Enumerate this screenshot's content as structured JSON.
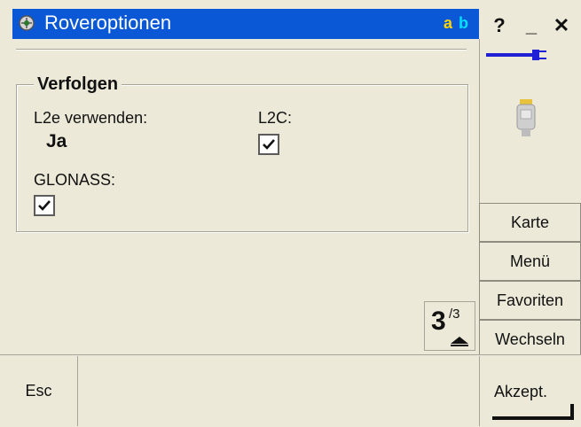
{
  "window": {
    "title": "Roveroptionen",
    "input_mode_a": "a",
    "input_mode_b": "b",
    "help_label": "?",
    "minimize_label": "_",
    "close_label": "✕"
  },
  "form": {
    "group_title": "Verfolgen",
    "l2e_label": "L2e verwenden:",
    "l2e_value": "Ja",
    "l2c_label": "L2C:",
    "l2c_checked": true,
    "glonass_label": "GLONASS:",
    "glonass_checked": true
  },
  "pager": {
    "current": "3",
    "total": "/3"
  },
  "sidebar": {
    "buttons": [
      {
        "label": "Karte"
      },
      {
        "label": "Menü"
      },
      {
        "label": "Favoriten"
      },
      {
        "label": "Wechseln"
      }
    ]
  },
  "bottom": {
    "esc_label": "Esc",
    "accept_label": "Akzept."
  },
  "colors": {
    "titlebar": "#0a58d6",
    "background": "#ECE9D8",
    "status_accent": "#1f1fd6"
  }
}
